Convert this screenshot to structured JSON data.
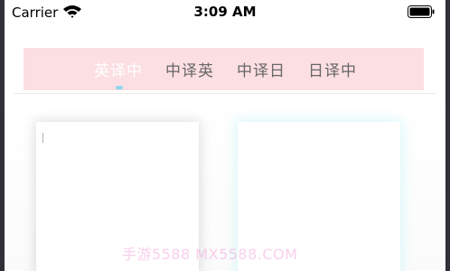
{
  "status_bar": {
    "carrier": "Carrier",
    "time": "3:09 AM",
    "wifi_icon": "wifi-icon",
    "battery_icon": "battery-icon"
  },
  "tabs": [
    {
      "label": "英译中",
      "active": true
    },
    {
      "label": "中译英",
      "active": false
    },
    {
      "label": "中译日",
      "active": false
    },
    {
      "label": "日译中",
      "active": false
    }
  ],
  "colors": {
    "tab_bar_bg": "#fcdfe2",
    "active_tab_text": "#ffffff",
    "inactive_tab_text": "#666666",
    "indicator": "#8fd6f0"
  },
  "input_card": {
    "value": ""
  },
  "output_card": {
    "value": ""
  },
  "watermark": "手游5588    MX5588.COM"
}
